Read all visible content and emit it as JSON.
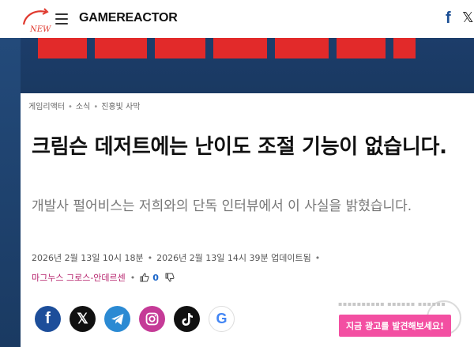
{
  "header": {
    "new_badge": "NEW",
    "brand": "GAMEREACTOR",
    "menu_icon": "hamburger-icon",
    "facebook_icon": "facebook-icon",
    "x_icon": "x-icon"
  },
  "breadcrumb": {
    "items": [
      "게임리액터",
      "소식",
      "진홍빛 사막"
    ]
  },
  "article": {
    "title": "크림슨 데저트에는 난이도 조절 기능이 없습니다.",
    "subtitle": "개발사 펄어비스는 저희와의 단독 인터뷰에서 이 사실을 밝혔습니다.",
    "published": "2026년 2월 13일 10시 18분",
    "updated": "2026년 2월 13일 14시 39분 업데이트됨",
    "author": "마그누스 그로스-안데르센",
    "likes": "0"
  },
  "social": [
    "facebook",
    "x",
    "telegram",
    "instagram",
    "tiktok",
    "google"
  ],
  "overlay": {
    "promo_label": "지금 광고를 발견해보세요!"
  },
  "colors": {
    "brand_red": "#e22a2a",
    "author_pink": "#b51f6a",
    "like_blue": "#1b66c9",
    "promo_pink": "#f34fa2",
    "facebook": "#1d4e9a",
    "telegram": "#2b8ad3",
    "instagram": "#c53b97"
  }
}
